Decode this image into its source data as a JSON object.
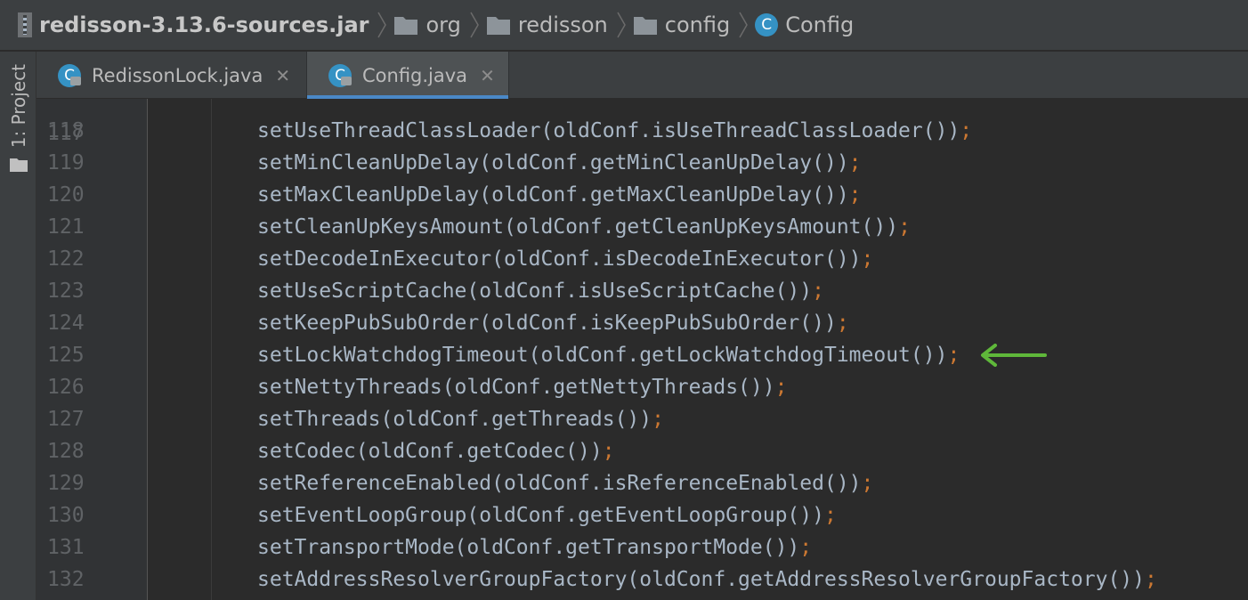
{
  "breadcrumb": [
    {
      "label": "redisson-3.13.6-sources.jar",
      "icon": "jar-icon"
    },
    {
      "label": "org",
      "icon": "folder-icon"
    },
    {
      "label": "redisson",
      "icon": "folder-icon"
    },
    {
      "label": "config",
      "icon": "folder-icon"
    },
    {
      "label": "Config",
      "icon": "class-icon"
    }
  ],
  "sidebar": {
    "project_label": "1: Project"
  },
  "tabs": [
    {
      "label": "RedissonLock.java",
      "active": false,
      "icon_letter": "C"
    },
    {
      "label": "Config.java",
      "active": true,
      "icon_letter": "C"
    }
  ],
  "editor": {
    "partial_line_number": "117",
    "lines": [
      {
        "num": "118",
        "code": "setUseThreadClassLoader(oldConf.isUseThreadClassLoader())"
      },
      {
        "num": "119",
        "code": "setMinCleanUpDelay(oldConf.getMinCleanUpDelay())"
      },
      {
        "num": "120",
        "code": "setMaxCleanUpDelay(oldConf.getMaxCleanUpDelay())"
      },
      {
        "num": "121",
        "code": "setCleanUpKeysAmount(oldConf.getCleanUpKeysAmount())"
      },
      {
        "num": "122",
        "code": "setDecodeInExecutor(oldConf.isDecodeInExecutor())"
      },
      {
        "num": "123",
        "code": "setUseScriptCache(oldConf.isUseScriptCache())"
      },
      {
        "num": "124",
        "code": "setKeepPubSubOrder(oldConf.isKeepPubSubOrder())"
      },
      {
        "num": "125",
        "code": "setLockWatchdogTimeout(oldConf.getLockWatchdogTimeout())"
      },
      {
        "num": "126",
        "code": "setNettyThreads(oldConf.getNettyThreads())"
      },
      {
        "num": "127",
        "code": "setThreads(oldConf.getThreads())"
      },
      {
        "num": "128",
        "code": "setCodec(oldConf.getCodec())"
      },
      {
        "num": "129",
        "code": "setReferenceEnabled(oldConf.isReferenceEnabled())"
      },
      {
        "num": "130",
        "code": "setEventLoopGroup(oldConf.getEventLoopGroup())"
      },
      {
        "num": "131",
        "code": "setTransportMode(oldConf.getTransportMode())"
      },
      {
        "num": "132",
        "code": "setAddressResolverGroupFactory(oldConf.getAddressResolverGroupFactory())"
      }
    ],
    "terminator": ";",
    "highlighted_line": "125"
  },
  "colors": {
    "accent_tab": "#4a88c7",
    "annotation_arrow": "#5fb83a",
    "semicolon": "#cc7832",
    "code_text": "#a9b7c6"
  }
}
